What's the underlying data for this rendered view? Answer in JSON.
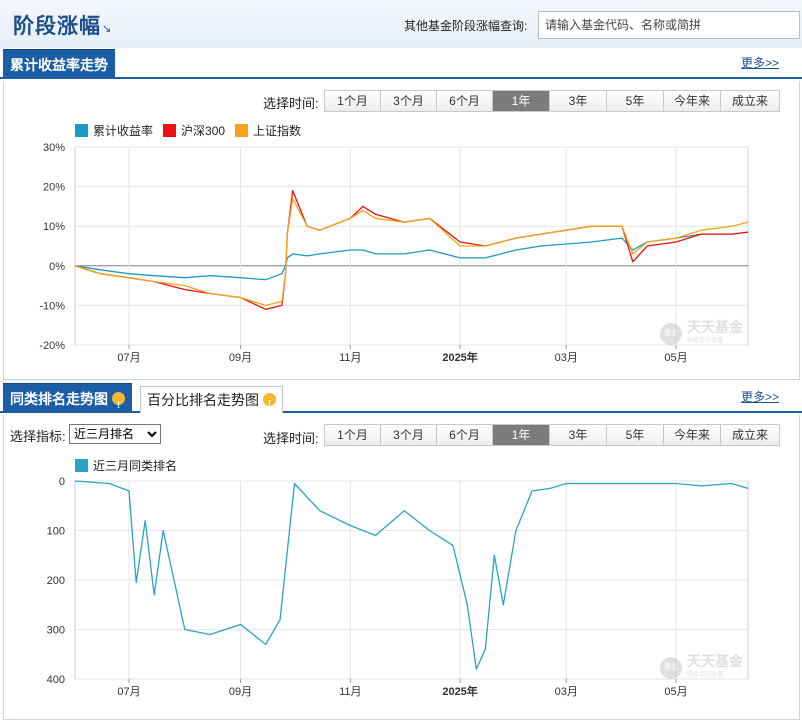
{
  "header": {
    "title": "阶段涨幅",
    "arrow": "↘",
    "query_label": "其他基金阶段涨幅查询:",
    "query_placeholder": "请输入基金代码、名称或简拼"
  },
  "section1": {
    "tab": "累计收益率走势",
    "more": "更多>>",
    "time_label": "选择时间:",
    "buttons": [
      "1个月",
      "3个月",
      "6个月",
      "1年",
      "3年",
      "5年",
      "今年来",
      "成立来"
    ],
    "active": "1年"
  },
  "section2": {
    "tab_active": "同类排名走势图",
    "tab_inactive": "百分比排名走势图",
    "more": "更多>>",
    "indicator_label": "选择指标:",
    "indicator_value": "近三月排名",
    "time_label": "选择时间:",
    "buttons": [
      "1个月",
      "3个月",
      "6个月",
      "1年",
      "3年",
      "5年",
      "今年来",
      "成立来"
    ],
    "active": "1年"
  },
  "watermark": {
    "logo": "基金",
    "name": "天天基金",
    "sub": "链接您与财富"
  },
  "colors": {
    "fund": "#1a9bc4",
    "hs300": "#ee1111",
    "sz": "#f5a31a",
    "rank": "#2aa3c7"
  },
  "chart_data": [
    {
      "type": "line",
      "x_labels": [
        "07月",
        "09月",
        "11月",
        "2025年",
        "03月",
        "05月"
      ],
      "ylabels": [
        "30%",
        "20%",
        "10%",
        "0%",
        "-10%",
        "-20%"
      ],
      "ylim": [
        -20,
        30
      ],
      "unit": "%",
      "grid": true,
      "legend_position": "top-left",
      "x": [
        "2024-06-01",
        "2024-06-15",
        "2024-07-01",
        "2024-07-15",
        "2024-08-01",
        "2024-08-15",
        "2024-09-01",
        "2024-09-15",
        "2024-09-24",
        "2024-09-26",
        "2024-09-27",
        "2024-09-30",
        "2024-10-08",
        "2024-10-15",
        "2024-11-01",
        "2024-11-08",
        "2024-11-15",
        "2024-12-01",
        "2024-12-15",
        "2025-01-01",
        "2025-01-15",
        "2025-02-01",
        "2025-02-15",
        "2025-03-01",
        "2025-03-15",
        "2025-04-01",
        "2025-04-07",
        "2025-04-15",
        "2025-05-01",
        "2025-05-15",
        "2025-06-01",
        "2025-06-10"
      ],
      "series": [
        {
          "name": "累计收益率",
          "values": [
            0,
            -1,
            -2,
            -2.5,
            -3,
            -2.5,
            -3,
            -3.5,
            -2,
            0,
            2,
            3,
            2.5,
            3,
            4,
            4,
            3,
            3,
            4,
            2,
            2,
            4,
            5,
            5.5,
            6,
            7,
            4,
            6,
            7,
            8,
            8,
            8.5
          ]
        },
        {
          "name": "沪深300",
          "values": [
            0,
            -2,
            -3,
            -4,
            -6,
            -7,
            -8,
            -11,
            -10,
            -2,
            8,
            19,
            10,
            9,
            12,
            15,
            13,
            11,
            12,
            6,
            5,
            7,
            8,
            9,
            10,
            10,
            1,
            5,
            6,
            8,
            8,
            8.5
          ]
        },
        {
          "name": "上证指数",
          "values": [
            0,
            -2,
            -3,
            -4,
            -5,
            -7,
            -8,
            -10,
            -9,
            -2,
            8,
            17,
            10,
            9,
            12,
            14,
            12,
            11,
            12,
            5,
            5,
            7,
            8,
            9,
            10,
            10,
            3,
            6,
            7,
            9,
            10,
            11
          ]
        }
      ]
    },
    {
      "type": "line",
      "x_labels": [
        "07月",
        "09月",
        "11月",
        "2025年",
        "03月",
        "05月"
      ],
      "ylabels": [
        "0",
        "100",
        "200",
        "300",
        "400"
      ],
      "ylim": [
        0,
        400
      ],
      "reversed_y": true,
      "grid": true,
      "legend_position": "top-left",
      "x": [
        "2024-06-01",
        "2024-06-20",
        "2024-07-01",
        "2024-07-05",
        "2024-07-10",
        "2024-07-15",
        "2024-07-20",
        "2024-08-01",
        "2024-08-15",
        "2024-09-01",
        "2024-09-15",
        "2024-09-23",
        "2024-09-25",
        "2024-10-01",
        "2024-10-15",
        "2024-11-01",
        "2024-11-15",
        "2024-12-01",
        "2024-12-15",
        "2024-12-28",
        "2025-01-05",
        "2025-01-10",
        "2025-01-15",
        "2025-01-20",
        "2025-01-25",
        "2025-02-01",
        "2025-02-10",
        "2025-02-20",
        "2025-03-01",
        "2025-03-15",
        "2025-04-01",
        "2025-04-15",
        "2025-05-01",
        "2025-05-15",
        "2025-06-01",
        "2025-06-10"
      ],
      "series": [
        {
          "name": "近三月同类排名",
          "values": [
            0,
            5,
            20,
            205,
            80,
            230,
            100,
            300,
            310,
            290,
            330,
            280,
            210,
            5,
            60,
            90,
            110,
            60,
            100,
            130,
            250,
            380,
            340,
            150,
            250,
            100,
            20,
            15,
            5,
            5,
            5,
            5,
            5,
            10,
            5,
            15
          ]
        }
      ]
    }
  ]
}
